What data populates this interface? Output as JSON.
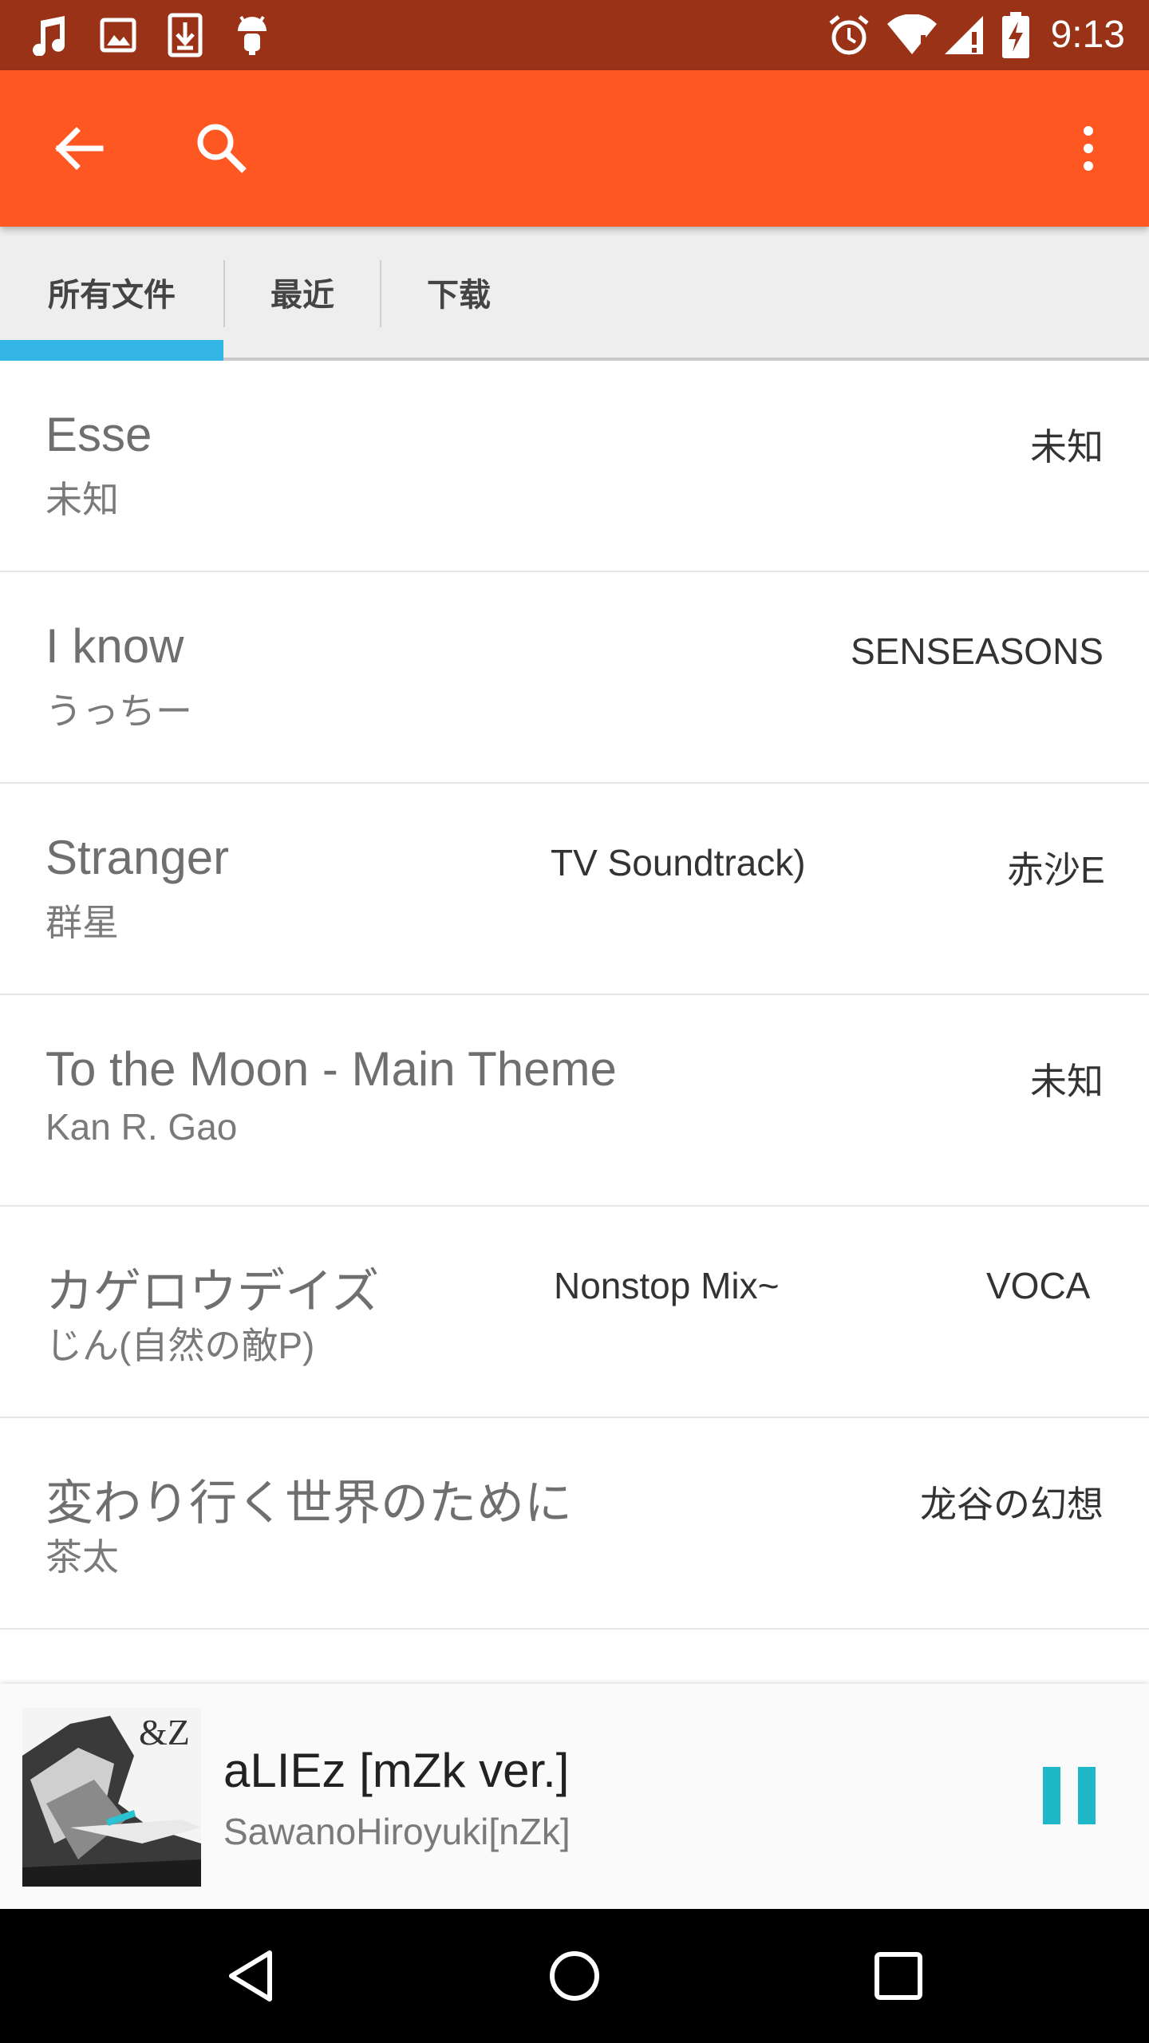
{
  "status_bar": {
    "time": "9:13",
    "left_icons": [
      "music-note-icon",
      "image-icon",
      "download-icon",
      "android-icon"
    ],
    "right_icons": [
      "alarm-icon",
      "wifi-icon",
      "signal-icon",
      "battery-charging-icon"
    ],
    "background": "#9a3218"
  },
  "toolbar": {
    "background": "#ff5722",
    "icons": [
      "back-arrow-icon",
      "search-icon",
      "overflow-menu-icon"
    ]
  },
  "tabs": [
    {
      "label": "所有文件",
      "selected": true
    },
    {
      "label": "最近",
      "selected": false
    },
    {
      "label": "下载",
      "selected": false
    }
  ],
  "tab_indicator_color": "#33b5e5",
  "songs": [
    {
      "title": "Esse",
      "artist": "未知",
      "album": "",
      "right": "未知"
    },
    {
      "title": "I know",
      "artist": "うっちー",
      "album": "",
      "right": "SENSEASONS"
    },
    {
      "title": "Stranger",
      "artist": "群星",
      "album": "TV Soundtrack)",
      "right": "赤沙E"
    },
    {
      "title": "To the Moon - Main Theme",
      "artist": "Kan R. Gao",
      "album": "",
      "right": "未知"
    },
    {
      "title": "カゲロウデイズ",
      "artist": "じん(自然の敵P)",
      "album": "Nonstop Mix~",
      "right": "VOCA"
    },
    {
      "title": "変わり行く世界のために",
      "artist": "茶太",
      "album": "",
      "right": "龙谷の幻想"
    }
  ],
  "now_playing": {
    "title": "aLIEz [mZk ver.]",
    "artist": "SawanoHiroyuki[nZk]",
    "album_art_text": "&Z",
    "pause_color": "#1fb8c9"
  },
  "nav_bar": {
    "icons": [
      "nav-back-icon",
      "nav-home-icon",
      "nav-recents-icon"
    ]
  }
}
